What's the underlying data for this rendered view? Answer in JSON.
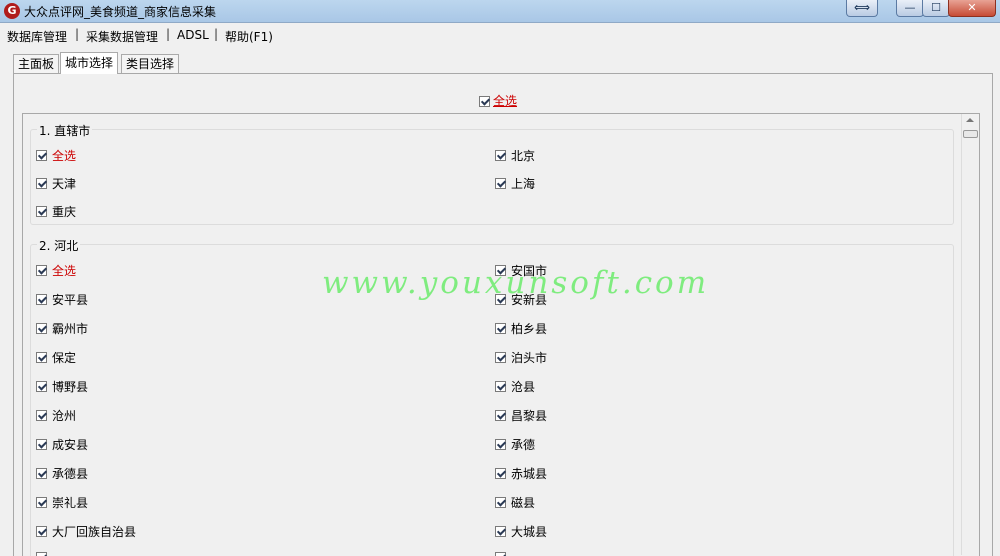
{
  "window": {
    "title": "大众点评网_美食频道_商家信息采集",
    "icon": "app-logo-icon",
    "controls": {
      "resize": "⟺",
      "minimize": "—",
      "maximize": "☐",
      "close": "✕"
    }
  },
  "menu": {
    "items": [
      "数据库管理",
      "采集数据管理",
      "ADSL",
      "帮助(F1)"
    ],
    "separator": "|"
  },
  "tabs": [
    "主面板",
    "城市选择",
    "类目选择"
  ],
  "active_tab": "城市选择",
  "select_all_top": "全选",
  "groups": [
    {
      "title": "1. 直辖市",
      "left": [
        "全选",
        "天津",
        "重庆"
      ],
      "right": [
        "北京",
        "上海"
      ]
    },
    {
      "title": "2. 河北",
      "left": [
        "全选",
        "安平县",
        "霸州市",
        "保定",
        "博野县",
        "沧州",
        "成安县",
        "承德县",
        "崇礼县",
        "大厂回族自治县"
      ],
      "right": [
        "安国市",
        "安新县",
        "柏乡县",
        "泊头市",
        "沧县",
        "昌黎县",
        "承德",
        "赤城县",
        "磁县",
        "大城县"
      ]
    }
  ],
  "watermark": "www.youxunsoft.com",
  "colors": {
    "select_all": "#cc0000",
    "watermark": "#5aeb5a"
  }
}
